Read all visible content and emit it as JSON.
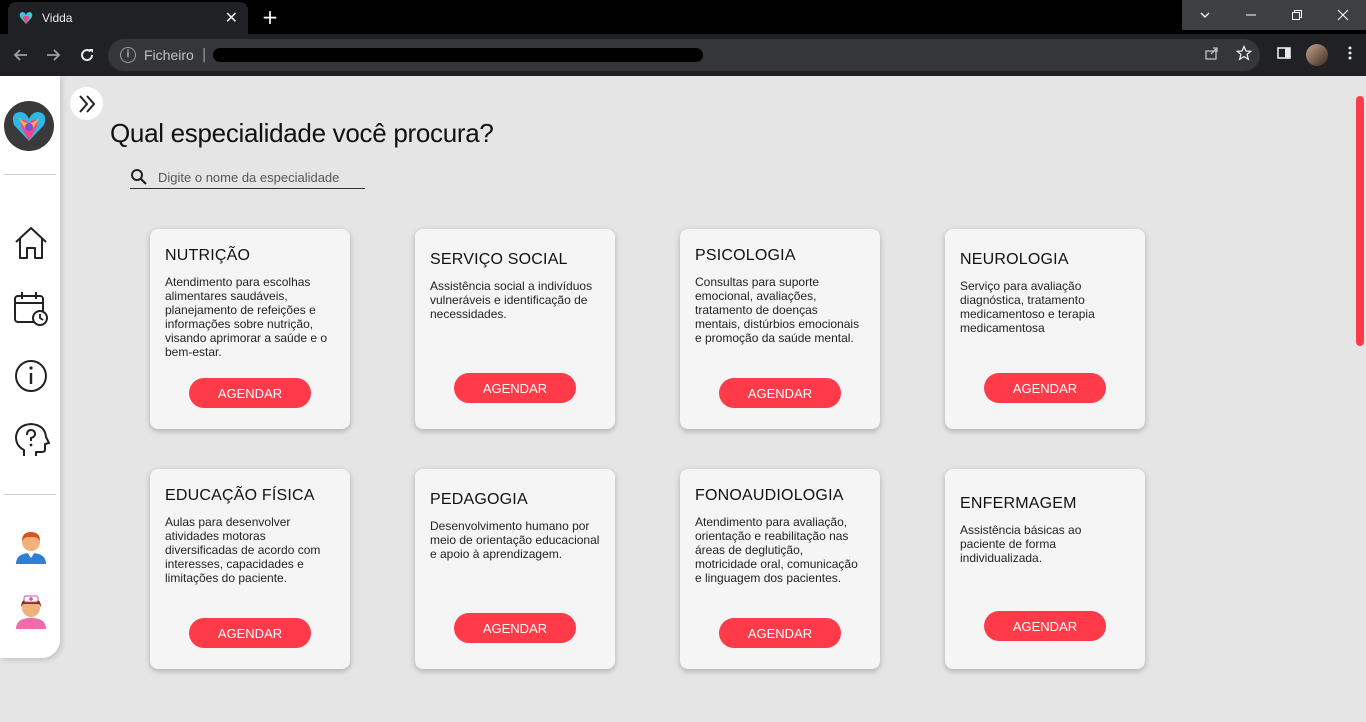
{
  "browser": {
    "tab_title": "Vidda",
    "tab_close": "✕",
    "new_tab": "+",
    "address_label": "Ficheiro",
    "address_separator": "|"
  },
  "page": {
    "title": "Qual especialidade você procura?",
    "search_placeholder": "Digite o nome da especialidade"
  },
  "cards": [
    {
      "title": "NUTRIÇÃO",
      "description": "Atendimento para escolhas alimentares saudáveis, planejamento de refeições e informações sobre nutrição, visando aprimorar a saúde e o bem-estar.",
      "button": "AGENDAR"
    },
    {
      "title": "SERVIÇO SOCIAL",
      "description": "Assistência social a indivíduos vulneráveis e identificação de necessidades.",
      "button": "AGENDAR"
    },
    {
      "title": "PSICOLOGIA",
      "description": "Consultas para suporte emocional, avaliações, tratamento de doenças mentais, distúrbios emocionais e promoção da saúde mental.",
      "button": "AGENDAR"
    },
    {
      "title": "NEUROLOGIA",
      "description": "Serviço para avaliação diagnóstica, tratamento medicamentoso e terapia medicamentosa",
      "button": "AGENDAR"
    },
    {
      "title": "EDUCAÇÃO FÍSICA",
      "description": "Aulas para desenvolver atividades motoras diversificadas de acordo com interesses, capacidades e limitações do paciente.",
      "button": "AGENDAR"
    },
    {
      "title": "PEDAGOGIA",
      "description": "Desenvolvimento humano por meio de orientação educacional e apoio à aprendizagem.",
      "button": "AGENDAR"
    },
    {
      "title": "FONOAUDIOLOGIA",
      "description": "Atendimento para avaliação, orientação e reabilitação nas áreas de deglutição, motricidade oral, comunicação e linguagem dos pacientes.",
      "button": "AGENDAR"
    },
    {
      "title": "ENFERMAGEM",
      "description": "Assistência básicas ao paciente de forma individualizada.",
      "button": "AGENDAR"
    }
  ],
  "colors": {
    "accent": "#ff3b4a",
    "card_bg": "#f5f5f5",
    "page_bg": "#e5e5e5"
  },
  "icons": [
    "home-icon",
    "calendar-clock-icon",
    "info-icon",
    "help-head-icon",
    "patient-avatar-icon",
    "nurse-avatar-icon"
  ]
}
